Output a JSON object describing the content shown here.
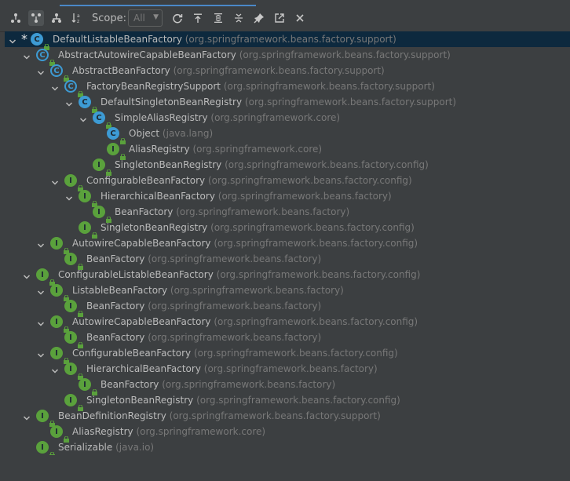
{
  "toolbar": {
    "scope_label": "Scope:",
    "scope_value": "All",
    "buttons": [
      {
        "name": "subtypes-hierarchy-icon"
      },
      {
        "name": "supertypes-hierarchy-icon"
      },
      {
        "name": "class-hierarchy-icon"
      },
      {
        "name": "sort-alphabetically-icon"
      },
      {
        "name": "refresh-icon"
      },
      {
        "name": "export-icon"
      },
      {
        "name": "expand-all-icon"
      },
      {
        "name": "collapse-all-icon"
      },
      {
        "name": "pin-icon"
      },
      {
        "name": "open-in-new-icon"
      },
      {
        "name": "close-icon"
      }
    ]
  },
  "tree": {
    "rows": [
      {
        "depth": 0,
        "expanded": true,
        "star": true,
        "kind": "class",
        "name": "DefaultListableBeanFactory",
        "pkg": "(org.springframework.beans.factory.support)",
        "selected": true
      },
      {
        "depth": 1,
        "expanded": true,
        "kind": "abstract",
        "name": "AbstractAutowireCapableBeanFactory",
        "pkg": "(org.springframework.beans.factory.support)"
      },
      {
        "depth": 2,
        "expanded": true,
        "kind": "abstract",
        "name": "AbstractBeanFactory",
        "pkg": "(org.springframework.beans.factory.support)"
      },
      {
        "depth": 3,
        "expanded": true,
        "kind": "abstract",
        "name": "FactoryBeanRegistrySupport",
        "pkg": "(org.springframework.beans.factory.support)"
      },
      {
        "depth": 4,
        "expanded": true,
        "kind": "class",
        "name": "DefaultSingletonBeanRegistry",
        "pkg": "(org.springframework.beans.factory.support)"
      },
      {
        "depth": 5,
        "expanded": true,
        "kind": "class",
        "name": "SimpleAliasRegistry",
        "pkg": "(org.springframework.core)"
      },
      {
        "depth": 6,
        "expanded": null,
        "kind": "class",
        "name": "Object",
        "pkg": "(java.lang)"
      },
      {
        "depth": 6,
        "expanded": null,
        "kind": "iface",
        "name": "AliasRegistry",
        "pkg": "(org.springframework.core)"
      },
      {
        "depth": 5,
        "expanded": null,
        "kind": "iface",
        "name": "SingletonBeanRegistry",
        "pkg": "(org.springframework.beans.factory.config)"
      },
      {
        "depth": 3,
        "expanded": true,
        "kind": "iface",
        "name": "ConfigurableBeanFactory",
        "pkg": "(org.springframework.beans.factory.config)"
      },
      {
        "depth": 4,
        "expanded": true,
        "kind": "iface",
        "name": "HierarchicalBeanFactory",
        "pkg": "(org.springframework.beans.factory)"
      },
      {
        "depth": 5,
        "expanded": null,
        "kind": "iface",
        "name": "BeanFactory",
        "pkg": "(org.springframework.beans.factory)"
      },
      {
        "depth": 4,
        "expanded": null,
        "kind": "iface",
        "name": "SingletonBeanRegistry",
        "pkg": "(org.springframework.beans.factory.config)"
      },
      {
        "depth": 2,
        "expanded": true,
        "kind": "iface",
        "name": "AutowireCapableBeanFactory",
        "pkg": "(org.springframework.beans.factory.config)"
      },
      {
        "depth": 3,
        "expanded": null,
        "kind": "iface",
        "name": "BeanFactory",
        "pkg": "(org.springframework.beans.factory)"
      },
      {
        "depth": 1,
        "expanded": true,
        "kind": "iface",
        "name": "ConfigurableListableBeanFactory",
        "pkg": "(org.springframework.beans.factory.config)"
      },
      {
        "depth": 2,
        "expanded": true,
        "kind": "iface",
        "name": "ListableBeanFactory",
        "pkg": "(org.springframework.beans.factory)"
      },
      {
        "depth": 3,
        "expanded": null,
        "kind": "iface",
        "name": "BeanFactory",
        "pkg": "(org.springframework.beans.factory)"
      },
      {
        "depth": 2,
        "expanded": true,
        "kind": "iface",
        "name": "AutowireCapableBeanFactory",
        "pkg": "(org.springframework.beans.factory.config)"
      },
      {
        "depth": 3,
        "expanded": null,
        "kind": "iface",
        "name": "BeanFactory",
        "pkg": "(org.springframework.beans.factory)"
      },
      {
        "depth": 2,
        "expanded": true,
        "kind": "iface",
        "name": "ConfigurableBeanFactory",
        "pkg": "(org.springframework.beans.factory.config)"
      },
      {
        "depth": 3,
        "expanded": true,
        "kind": "iface",
        "name": "HierarchicalBeanFactory",
        "pkg": "(org.springframework.beans.factory)"
      },
      {
        "depth": 4,
        "expanded": null,
        "kind": "iface",
        "name": "BeanFactory",
        "pkg": "(org.springframework.beans.factory)"
      },
      {
        "depth": 3,
        "expanded": null,
        "kind": "iface",
        "name": "SingletonBeanRegistry",
        "pkg": "(org.springframework.beans.factory.config)"
      },
      {
        "depth": 1,
        "expanded": true,
        "kind": "iface",
        "name": "BeanDefinitionRegistry",
        "pkg": "(org.springframework.beans.factory.support)"
      },
      {
        "depth": 2,
        "expanded": null,
        "kind": "iface",
        "name": "AliasRegistry",
        "pkg": "(org.springframework.core)"
      },
      {
        "depth": 1,
        "expanded": null,
        "kind": "iface",
        "name": "Serializable",
        "pkg": "(java.io)"
      }
    ]
  },
  "colors": {
    "background": "#3c3f41",
    "selection": "#0d293e",
    "class_icon": "#3d9bd4",
    "interface_icon": "#5aa13c",
    "package_text": "#787878",
    "name_text": "#bbbbbb"
  }
}
